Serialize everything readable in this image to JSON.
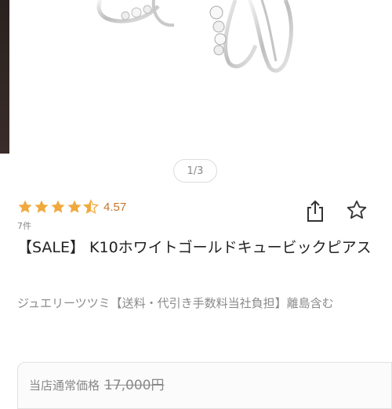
{
  "carousel": {
    "indicator": "1/3"
  },
  "rating": {
    "value": "4.57",
    "stars": 4.5,
    "review_count": "7件"
  },
  "product": {
    "title": "【SALE】 K10ホワイトゴールドキュービックピアス"
  },
  "shop": {
    "name": "ジュエリーツツミ【送料・代引き手数料当社負担】離島含む"
  },
  "price": {
    "label": "当店通常価格",
    "value": "17,000円"
  },
  "icons": {
    "share": "share-icon",
    "favorite": "star-outline-icon"
  },
  "colors": {
    "star": "#f0a93e",
    "rating_text": "#c8752b",
    "muted_text": "#8a8a8a"
  }
}
